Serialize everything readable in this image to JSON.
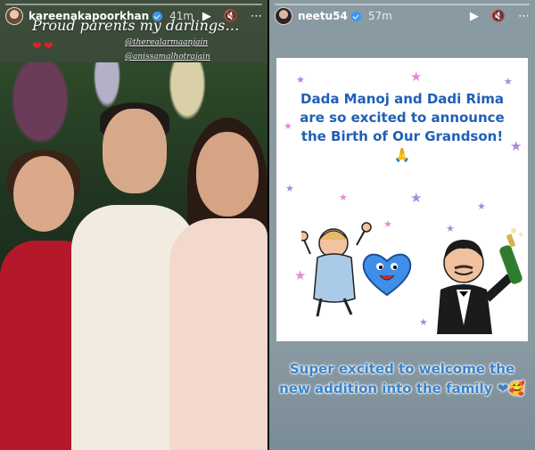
{
  "left_story": {
    "username": "kareenakapoorkhan",
    "time": "41m",
    "caption": "Proud parents my darlings…",
    "hearts": "❤❤",
    "mentions": [
      "@therealarmaanjain",
      "@anissamalhotrajain"
    ],
    "controls": {
      "play": "▶",
      "mute": "🔇",
      "more": "⋯"
    }
  },
  "right_story": {
    "username": "neetu54",
    "time": "57m",
    "card_text": "Dada Manoj and Dadi Rima are so excited to announce the Birth of Our Grandson! 🙏",
    "bottom_text": "Super excited to welcome the new addition into the family ❤🥰",
    "controls": {
      "play": "▶",
      "mute": "🔇",
      "more": "⋯"
    }
  },
  "colors": {
    "verified": "#3897f0",
    "card_text": "#1f5fb8",
    "bottom_text": "#3a82c8"
  },
  "icons": [
    "play-icon",
    "mute-icon",
    "more-icon",
    "verified-icon"
  ]
}
